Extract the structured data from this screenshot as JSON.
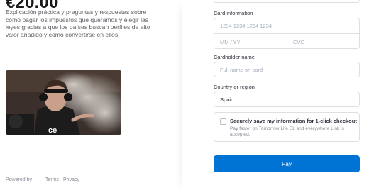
{
  "summary": {
    "price": "€20.00",
    "description": "Explicación práctica y preguntas y respuestas sobre cómo pagar los impuestos que queramos y elegir las leyes gracias a que los países buscan perfiles de alto valor añadido y como convertirse en ellos."
  },
  "footer": {
    "powered_by": "Powered by",
    "terms": "Terms",
    "privacy": "Privacy"
  },
  "form": {
    "card_label": "Card information",
    "card_number_placeholder": "1234 1234 1234 1234",
    "expiry_placeholder": "MM / YY",
    "cvc_placeholder": "CVC",
    "name_label": "Cardholder name",
    "name_placeholder": "Full name on card",
    "country_label": "Country or region",
    "country_value": "Spain",
    "save_title": "Securely save my information for 1-click checkout",
    "save_subtitle": "Pay faster on Tomorrow Life SL and everywhere Link is accepted.",
    "save_checked": false,
    "pay_label": "Pay"
  },
  "colors": {
    "accent": "#0074d4",
    "border": "#dcdfe4",
    "muted_text": "#8a8f98"
  },
  "icons": {
    "product_image": "product-thumbnail"
  }
}
